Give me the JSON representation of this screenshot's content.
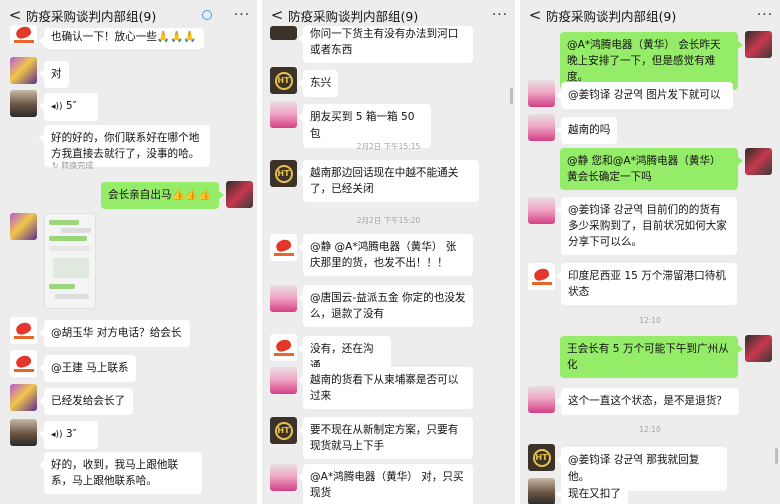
{
  "window": {
    "title": "防疫采购谈判内部组(9)",
    "more": "···",
    "back": "<"
  },
  "panel1": {
    "m1": "也确认一下！放心一些🙏🙏🙏",
    "m2": "对",
    "m3": "5″",
    "m4": "好的好的，你们联系好在哪个地方我直接去就行了，没事的哈。",
    "m4sub": "转换完成",
    "m5": "会长亲自出马👍👍👍",
    "m6": "@胡玉华  对方电话？给会长",
    "m7": "@王建  马上联系",
    "m8": "已经发给会长了",
    "m9": "3″",
    "m10": "好的，收到，我马上跟他联系，马上跟他联系哈。"
  },
  "panel2": {
    "m1": "你问一下货主有没有办法到河口或者东西",
    "m2": "东兴",
    "m3": "朋友买到 5 箱一箱 50 包",
    "t1": "2月2日 下午15:15",
    "m4": "越南那边回话现在中越不能通关了，已经关闭",
    "t2": "2月2日 下午15:20",
    "m5": "@静  @A*鸿腾电器（黄华） 张庆那里的货，也发不出！！！",
    "m6": "@唐国云-益派五金  你定的也没发么，退款了没有",
    "m7": "没有，还在沟通",
    "m8": "越南的货看下从柬埔寨是否可以过来",
    "m9": "要不现在从新制定方案，只要有现货就马上下手",
    "m10": "@A*鸿腾电器（黄华） 对，只买现货"
  },
  "panel3": {
    "m1": "@A*鸿腾电器（黄华） 会长昨天晚上安排了一下，但是感觉有难度。",
    "m2": "@姜钧译 강균역  图片发下就可以",
    "m3": "越南的吗",
    "m4": "@静  您和@A*鸿腾电器（黄华）黄会长确定一下吗",
    "m5": "@姜钧译 강균역  目前们的的货有多少采购到了，目前状况如何大家分享下可以么。",
    "m6": "印度尼西亚 15 万个滞留港口待机状态",
    "t1": "12:10",
    "m7": "王会长有 5 万个可能下午到广州从化",
    "m8": "这个一直这个状态，是不是退货？",
    "t2": "12:10",
    "m9": "@姜钧译 강균역 那我就回复他。",
    "m10": "现在又扣了"
  }
}
